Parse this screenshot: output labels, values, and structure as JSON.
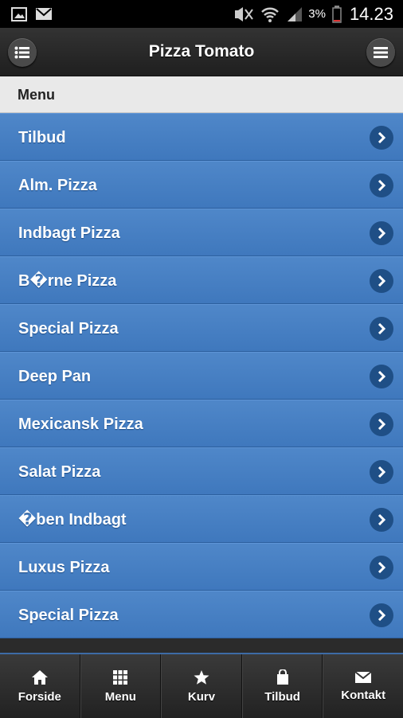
{
  "status_bar": {
    "battery_percent": "3%",
    "time": "14.23"
  },
  "header": {
    "title": "Pizza Tomato"
  },
  "list_divider": {
    "label": "Menu"
  },
  "menu_items": [
    {
      "label": "Tilbud"
    },
    {
      "label": "Alm. Pizza"
    },
    {
      "label": "Indbagt Pizza"
    },
    {
      "label": "B�rne Pizza"
    },
    {
      "label": "Special Pizza"
    },
    {
      "label": "Deep Pan"
    },
    {
      "label": "Mexicansk Pizza"
    },
    {
      "label": "Salat Pizza"
    },
    {
      "label": "�ben Indbagt"
    },
    {
      "label": "Luxus Pizza"
    },
    {
      "label": "Special Pizza"
    }
  ],
  "footer": {
    "tabs": [
      {
        "label": "Forside",
        "icon": "home-icon"
      },
      {
        "label": "Menu",
        "icon": "grid-icon"
      },
      {
        "label": "Kurv",
        "icon": "star-icon"
      },
      {
        "label": "Tilbud",
        "icon": "bag-icon"
      },
      {
        "label": "Kontakt",
        "icon": "mail-icon"
      }
    ]
  },
  "colors": {
    "accent": "#4a83c6",
    "header": "#222222",
    "divider": "#e9e9e9"
  }
}
